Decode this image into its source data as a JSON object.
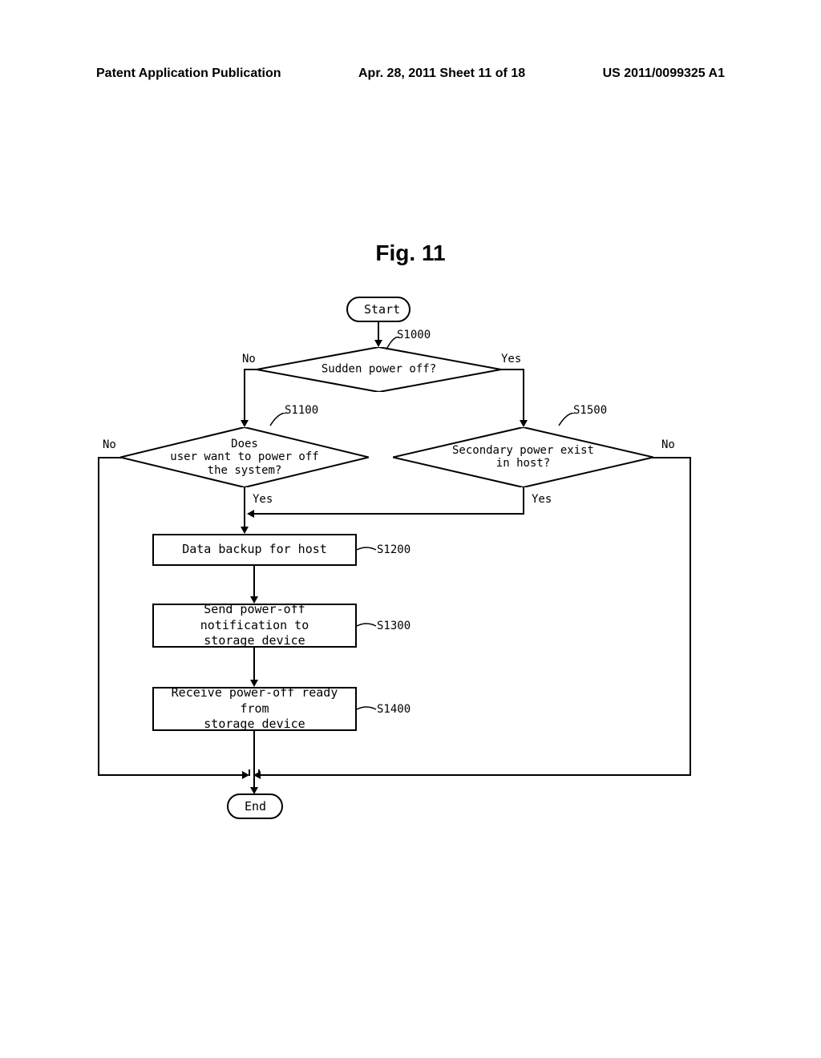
{
  "header": {
    "left": "Patent Application Publication",
    "center": "Apr. 28, 2011  Sheet 11 of 18",
    "right": "US 2011/0099325 A1"
  },
  "figure_title": "Fig. 11",
  "chart_data": {
    "type": "flowchart",
    "nodes": [
      {
        "id": "start",
        "type": "terminal",
        "text": "Start"
      },
      {
        "id": "s1000",
        "type": "decision",
        "text": "Sudden power off?",
        "label": "S1000"
      },
      {
        "id": "s1100",
        "type": "decision",
        "text": "Does\nuser want to power off\nthe system?",
        "label": "S1100"
      },
      {
        "id": "s1500",
        "type": "decision",
        "text": "Secondary power exist\nin host?",
        "label": "S1500"
      },
      {
        "id": "s1200",
        "type": "process",
        "text": "Data backup for host",
        "label": "S1200"
      },
      {
        "id": "s1300",
        "type": "process",
        "text": "Send power-off notification to\nstorage device",
        "label": "S1300"
      },
      {
        "id": "s1400",
        "type": "process",
        "text": "Receive power-off ready from\nstorage device",
        "label": "S1400"
      },
      {
        "id": "end",
        "type": "terminal",
        "text": "End"
      }
    ],
    "edges": [
      {
        "from": "start",
        "to": "s1000"
      },
      {
        "from": "s1000",
        "to": "s1100",
        "label": "No"
      },
      {
        "from": "s1000",
        "to": "s1500",
        "label": "Yes"
      },
      {
        "from": "s1100",
        "to": "s1200",
        "label": "Yes"
      },
      {
        "from": "s1100",
        "to": "end",
        "label": "No"
      },
      {
        "from": "s1500",
        "to": "s1200",
        "label": "Yes"
      },
      {
        "from": "s1500",
        "to": "end",
        "label": "No"
      },
      {
        "from": "s1200",
        "to": "s1300"
      },
      {
        "from": "s1300",
        "to": "s1400"
      },
      {
        "from": "s1400",
        "to": "end"
      }
    ]
  },
  "labels": {
    "no": "No",
    "yes": "Yes"
  }
}
